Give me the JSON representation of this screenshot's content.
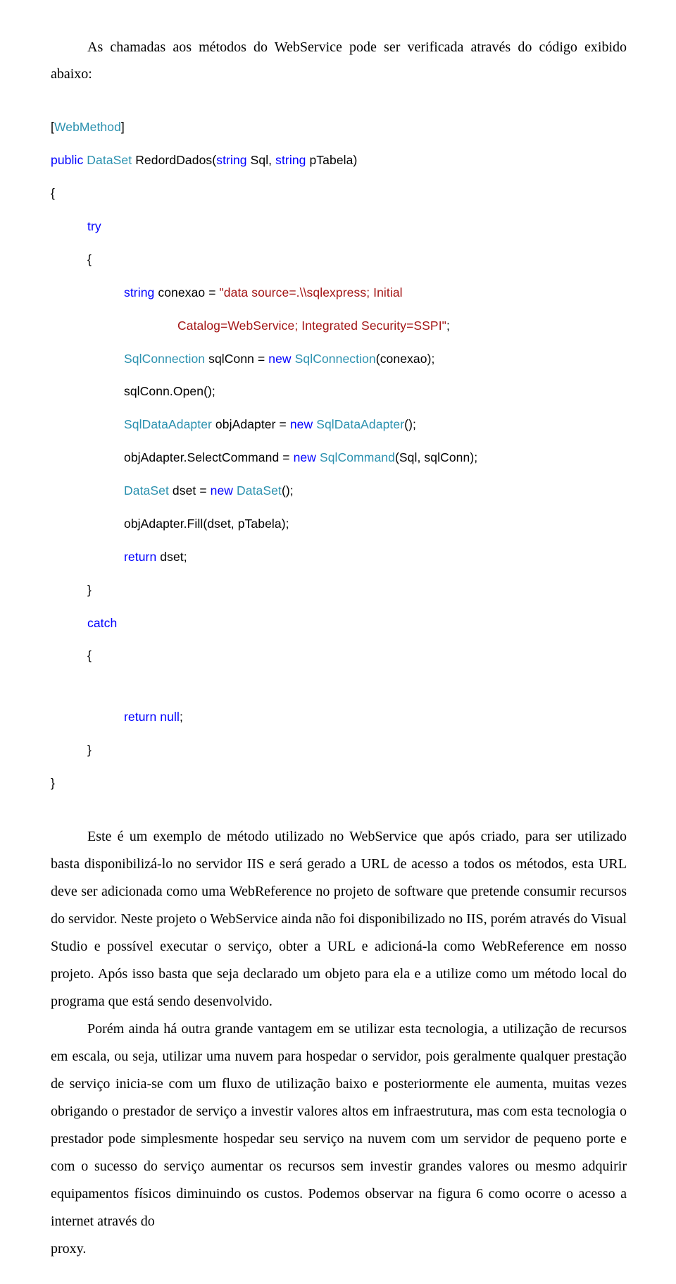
{
  "intro": "As chamadas aos métodos do WebService pode ser verificada através do código exibido abaixo:",
  "code": {
    "l01a": "[",
    "l01b": "WebMethod",
    "l01c": "]",
    "l02a": "public",
    "l02b": " ",
    "l02c": "DataSet",
    "l02d": " RedordDados(",
    "l02e": "string",
    "l02f": " Sql, ",
    "l02g": "string",
    "l02h": " pTabela)",
    "l03": "{",
    "l04": "try",
    "l05": "{",
    "l06a": "string",
    "l06b": " conexao = ",
    "l06c": "\"data source=.\\\\sqlexpress; Initial ",
    "l07": "Catalog=WebService; Integrated Security=SSPI\"",
    "l07b": ";",
    "l08a": "SqlConnection",
    "l08b": " sqlConn = ",
    "l08c": "new",
    "l08d": " ",
    "l08e": "SqlConnection",
    "l08f": "(conexao);",
    "l09": "sqlConn.Open();",
    "l10a": "SqlDataAdapter",
    "l10b": " objAdapter = ",
    "l10c": "new",
    "l10d": " ",
    "l10e": "SqlDataAdapter",
    "l10f": "();",
    "l11a": "objAdapter.SelectCommand = ",
    "l11b": "new",
    "l11c": " ",
    "l11d": "SqlCommand",
    "l11e": "(Sql, sqlConn);",
    "l12a": "DataSet",
    "l12b": " dset = ",
    "l12c": "new",
    "l12d": " ",
    "l12e": "DataSet",
    "l12f": "();",
    "l13": "objAdapter.Fill(dset, pTabela);",
    "l14a": "return",
    "l14b": " dset;",
    "l15": "}",
    "l16": "catch",
    "l17": "{",
    "l18a": "return",
    "l18b": " ",
    "l18c": "null",
    "l18d": ";",
    "l19": "}",
    "l20": "}"
  },
  "p1": "Este é um exemplo de método utilizado no WebService que após criado, para ser utilizado basta disponibilizá-lo no servidor IIS e será gerado a URL de acesso a todos os métodos, esta URL deve ser adicionada como uma WebReference no projeto de software que pretende consumir recursos do servidor. Neste projeto o WebService ainda não foi disponibilizado no IIS, porém através do Visual Studio e possível executar o serviço, obter a URL e adicioná-la como WebReference em nosso projeto. Após isso basta que seja declarado um objeto para ela e a utilize como um método local do programa que está sendo desenvolvido.",
  "p2": "Porém ainda há outra grande vantagem em se utilizar esta tecnologia, a utilização de recursos em escala, ou seja, utilizar uma nuvem para hospedar o servidor, pois geralmente qualquer prestação de serviço inicia-se com um fluxo de utilização baixo e posteriormente ele aumenta, muitas vezes obrigando o prestador de serviço a investir valores altos em infraestrutura, mas com esta tecnologia o prestador pode simplesmente hospedar seu serviço na nuvem com um servidor de pequeno porte e com o sucesso do serviço aumentar os recursos sem investir grandes valores ou mesmo adquirir equipamentos físicos diminuindo os custos. Podemos observar na figura 6 como ocorre o acesso a internet através do",
  "proxy": "proxy."
}
